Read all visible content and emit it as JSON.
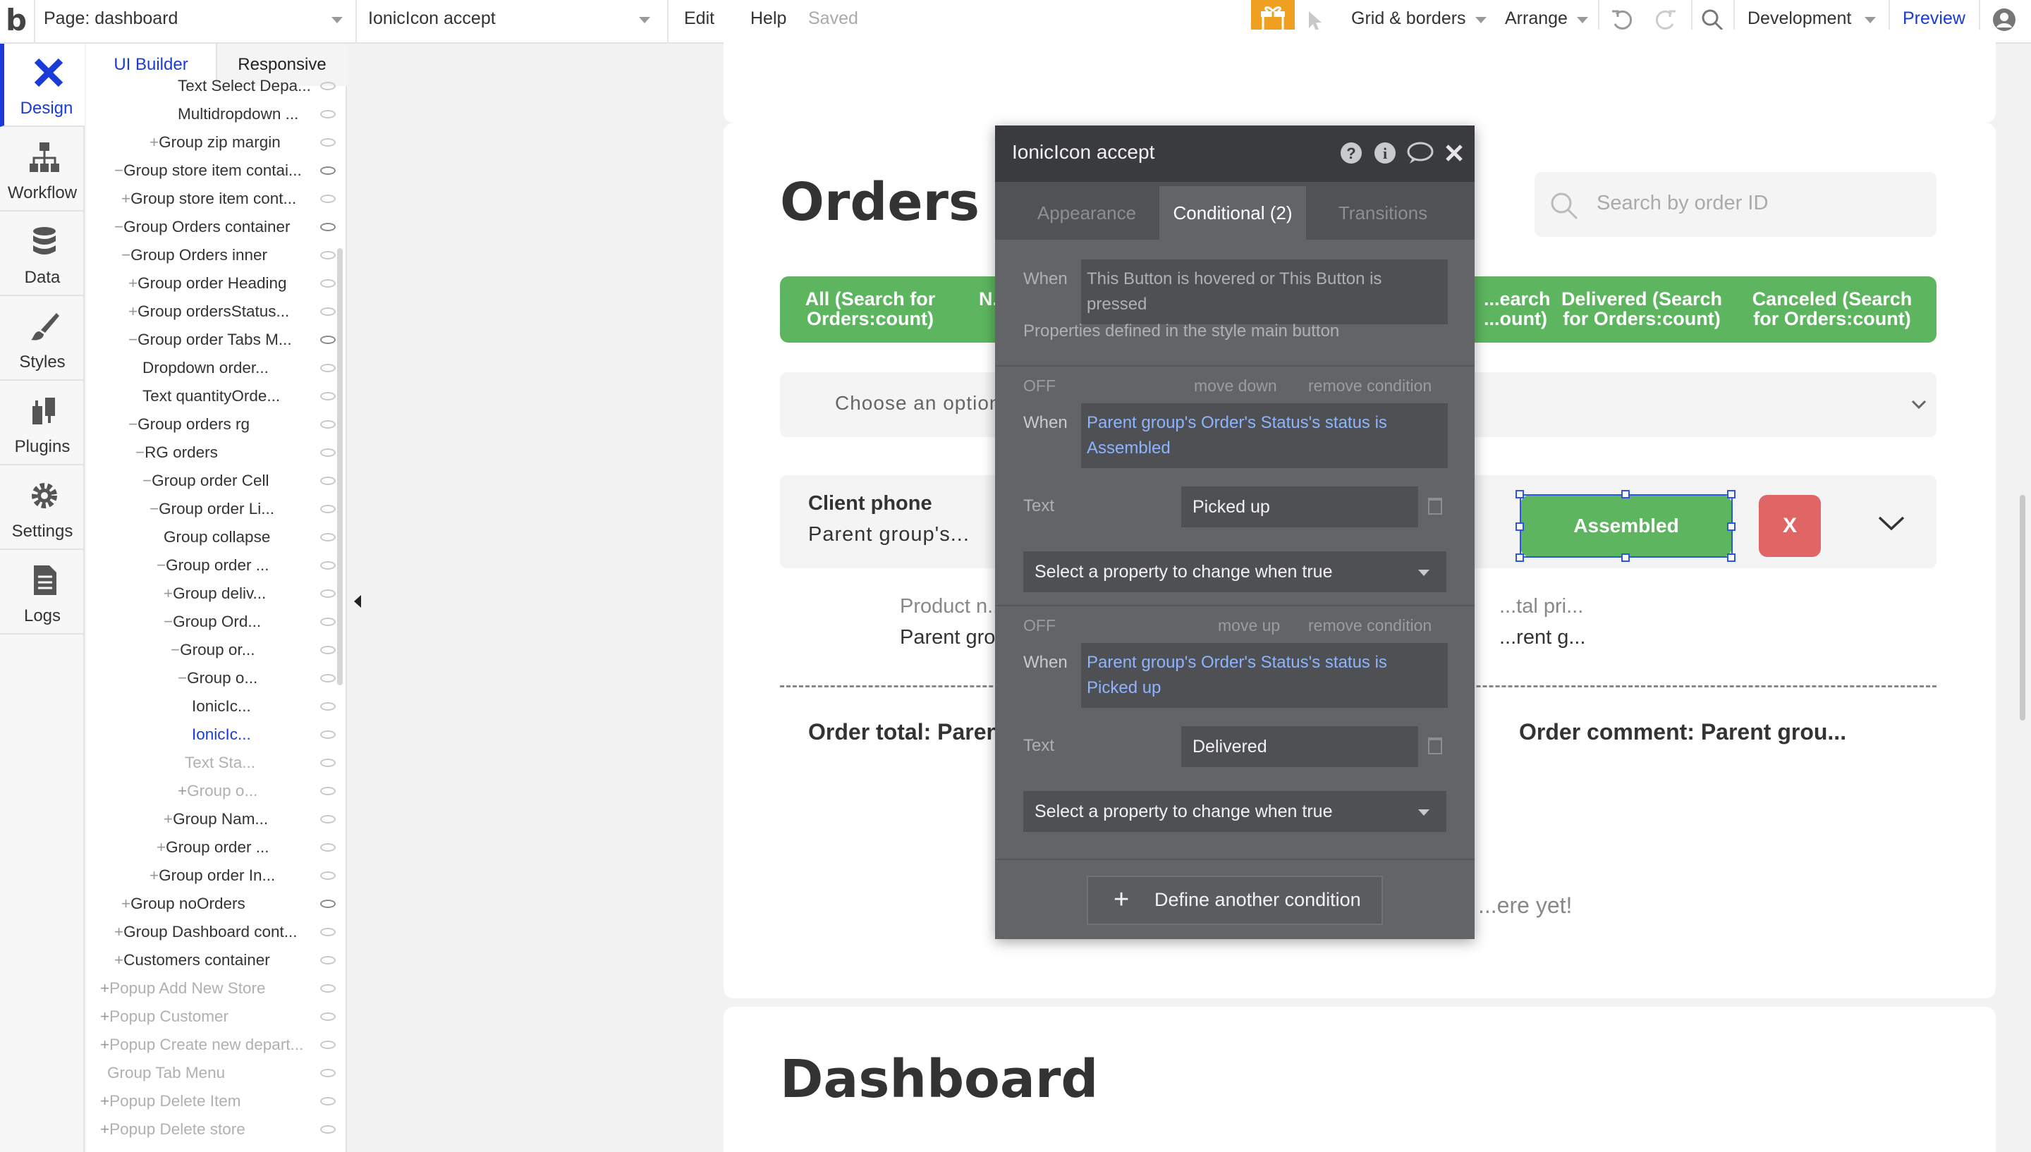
{
  "topbar": {
    "logo": "b",
    "page_selector": "Page: dashboard",
    "element_selector": "IonicIcon accept",
    "menu_edit": "Edit",
    "menu_help": "Help",
    "save_status": "Saved",
    "grid_borders": "Grid & borders",
    "arrange": "Arrange",
    "environment": "Development",
    "preview": "Preview"
  },
  "leftnav": {
    "items": [
      {
        "label": "Design",
        "icon": "design-icon",
        "active": true
      },
      {
        "label": "Workflow",
        "icon": "workflow-icon"
      },
      {
        "label": "Data",
        "icon": "database-icon"
      },
      {
        "label": "Styles",
        "icon": "brush-icon"
      },
      {
        "label": "Plugins",
        "icon": "plug-icon"
      },
      {
        "label": "Settings",
        "icon": "gear-icon"
      },
      {
        "label": "Logs",
        "icon": "document-icon"
      }
    ]
  },
  "tree": {
    "tabs": [
      "UI Builder",
      "Responsive"
    ],
    "rows": [
      {
        "label": "Text Select Depa...",
        "prefix": ""
      },
      {
        "label": "Multidropdown ...",
        "prefix": ""
      },
      {
        "label": "Group zip margin",
        "prefix": "+"
      },
      {
        "label": "Group store item contai...",
        "prefix": "−"
      },
      {
        "label": "Group store item cont...",
        "prefix": "+"
      },
      {
        "label": "Group Orders container",
        "prefix": "−"
      },
      {
        "label": "Group Orders inner",
        "prefix": "−"
      },
      {
        "label": "Group order Heading",
        "prefix": "+"
      },
      {
        "label": "Group ordersStatus...",
        "prefix": "+"
      },
      {
        "label": "Group order Tabs M...",
        "prefix": "−"
      },
      {
        "label": "Dropdown order...",
        "prefix": ""
      },
      {
        "label": "Text quantityOrde...",
        "prefix": ""
      },
      {
        "label": "Group orders rg",
        "prefix": "−"
      },
      {
        "label": "RG orders",
        "prefix": "−"
      },
      {
        "label": "Group order Cell",
        "prefix": "−"
      },
      {
        "label": "Group order Li...",
        "prefix": "−"
      },
      {
        "label": "Group collapse",
        "prefix": ""
      },
      {
        "label": "Group order ...",
        "prefix": "−"
      },
      {
        "label": "Group deliv...",
        "prefix": "+"
      },
      {
        "label": "Group Ord...",
        "prefix": "−"
      },
      {
        "label": "Group or...",
        "prefix": "−"
      },
      {
        "label": "Group o...",
        "prefix": "−"
      },
      {
        "label": "IonicIc...",
        "prefix": ""
      },
      {
        "label": "IonicIc...",
        "prefix": ""
      },
      {
        "label": "Text Sta...",
        "prefix": ""
      },
      {
        "label": "Group o...",
        "prefix": "+"
      },
      {
        "label": "Group Nam...",
        "prefix": "+"
      },
      {
        "label": "Group order ...",
        "prefix": "+"
      },
      {
        "label": "Group order In...",
        "prefix": "+"
      },
      {
        "label": "Group noOrders",
        "prefix": "+"
      },
      {
        "label": "Group Dashboard cont...",
        "prefix": "+"
      },
      {
        "label": "Customers container",
        "prefix": "+"
      },
      {
        "label": "Popup Add New Store",
        "prefix": "+"
      },
      {
        "label": "Popup Customer",
        "prefix": "+"
      },
      {
        "label": "Popup Create new depart...",
        "prefix": "+"
      },
      {
        "label": "Group Tab Menu",
        "prefix": ""
      },
      {
        "label": "Popup Delete Item",
        "prefix": "+"
      },
      {
        "label": "Popup Delete store",
        "prefix": "+"
      }
    ]
  },
  "canvas": {
    "orders_title": "Orders",
    "search_placeholder": "Search by order ID",
    "status_tabs": [
      "All (Search for Orders:count)",
      "N...",
      "...earch ...ount)",
      "Delivered (Search for Orders:count)",
      "Canceled (Search for Orders:count)"
    ],
    "dropdown_placeholder": "Choose an option...",
    "client_phone_label": "Client phone",
    "client_phone_value": "Parent group's...",
    "assembled_button": "Assembled",
    "cancel_button": "X",
    "product_label": "Product n...",
    "product_value": "Parent gro...",
    "total_price_label": "...tal pri...",
    "total_price_value": "...rent g...",
    "order_total": "Order total: Paren...",
    "order_comment": "Order comment: Parent grou...",
    "no_orders_text": "...ere yet!",
    "dashboard_title": "Dashboard"
  },
  "dialog": {
    "title": "IonicIcon accept",
    "tabs": [
      "Appearance",
      "Conditional (2)",
      "Transitions"
    ],
    "active_tab": "Conditional (2)",
    "base_when_label": "When",
    "base_condition": "This Button is hovered or This Button is pressed",
    "base_note": "Properties defined in the style main button",
    "conditions": [
      {
        "off": "OFF",
        "action_1": "move down",
        "action_2": "remove condition",
        "when_label": "When",
        "expression": "Parent group's Order's Status's status is Assembled",
        "property": "Text",
        "value": "Picked up",
        "add_property": "Select a property to change when true"
      },
      {
        "off": "OFF",
        "action_1": "move up",
        "action_2": "remove condition",
        "when_label": "When",
        "expression": "Parent group's Order's Status's status is Picked up",
        "property": "Text",
        "value": "Delivered",
        "add_property": "Select a property to change when true"
      }
    ],
    "define_button": "Define another condition"
  },
  "colors": {
    "accent_blue": "#1a3bd8",
    "green": "#5db55f",
    "red": "#e06666",
    "gift_orange": "#f0a020",
    "dialog_bg": "#626468"
  }
}
